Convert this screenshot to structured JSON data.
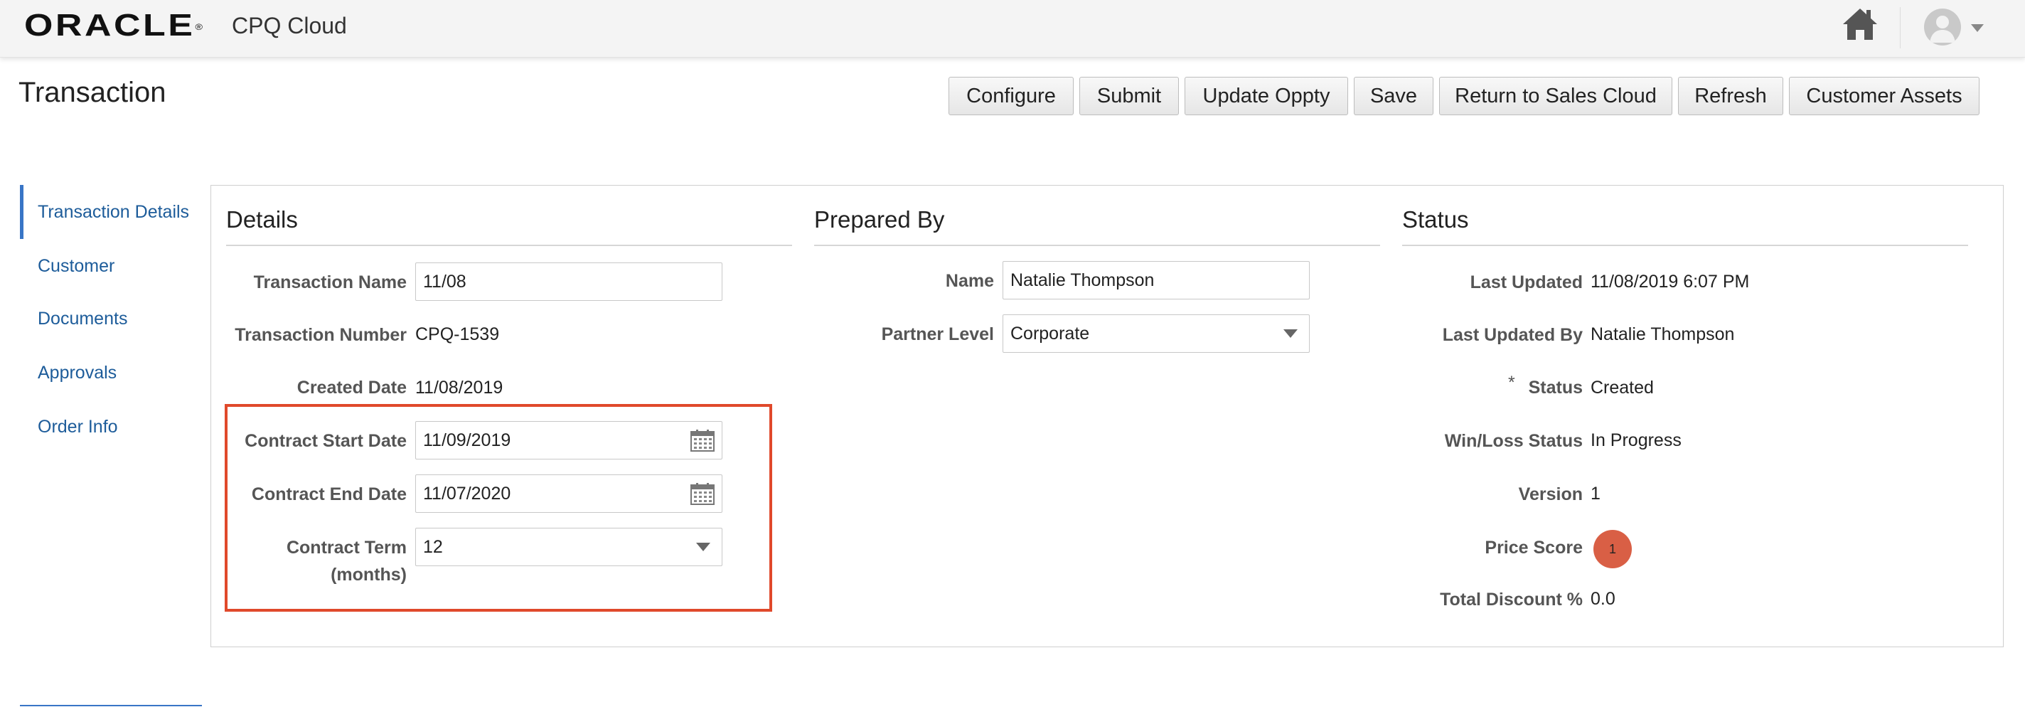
{
  "header": {
    "brand": "ORACLE",
    "brand_mark": "®",
    "product": "CPQ Cloud",
    "icons": [
      "home-icon",
      "avatar-icon",
      "chevron-down-icon"
    ]
  },
  "page": {
    "title": "Transaction",
    "actions": [
      "Configure",
      "Submit",
      "Update Oppty",
      "Save",
      "Return to Sales Cloud",
      "Refresh",
      "Customer Assets"
    ]
  },
  "nav": {
    "active": "Transaction Details",
    "items": [
      "Transaction Details",
      "Customer",
      "Documents",
      "Approvals",
      "Order Info"
    ]
  },
  "details": {
    "title": "Details",
    "transaction_name_label": "Transaction Name",
    "transaction_name_value": "11/08",
    "transaction_number_label": "Transaction Number",
    "transaction_number_value": "CPQ-1539",
    "created_date_label": "Created Date",
    "created_date_value": "11/08/2019",
    "contract_start_label": "Contract Start Date",
    "contract_start_value": "11/09/2019",
    "contract_end_label": "Contract End Date",
    "contract_end_value": "11/07/2020",
    "contract_term_label_1": "Contract Term",
    "contract_term_label_2": "(months)",
    "contract_term_value": "12"
  },
  "prepared_by": {
    "title": "Prepared By",
    "name_label": "Name",
    "name_value": "Natalie Thompson",
    "partner_level_label": "Partner Level",
    "partner_level_value": "Corporate"
  },
  "status": {
    "title": "Status",
    "last_updated_label": "Last Updated",
    "last_updated_value": "11/08/2019 6:07 PM",
    "last_updated_by_label": "Last Updated By",
    "last_updated_by_value": "Natalie Thompson",
    "required_mark": "*",
    "status_label": "Status",
    "status_value": "Created",
    "win_loss_label": "Win/Loss Status",
    "win_loss_value": "In Progress",
    "version_label": "Version",
    "version_value": "1",
    "price_score_label": "Price Score",
    "price_score_value": "1",
    "total_discount_label": "Total Discount %",
    "total_discount_value": "0.0"
  },
  "colors": {
    "accent": "#3875c6",
    "highlight": "#e0492b",
    "score_badge": "#d95f45",
    "link": "#1d5c9a"
  }
}
